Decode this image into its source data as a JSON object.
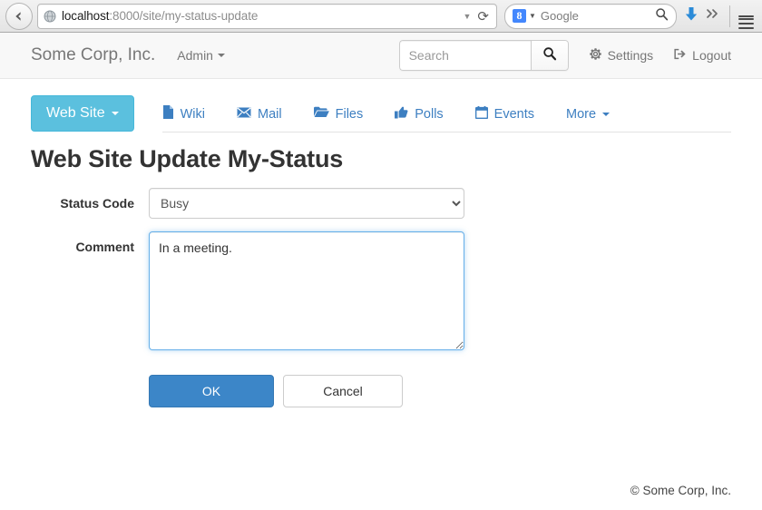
{
  "browser": {
    "back_icon": "back-arrow-icon",
    "site_icon": "globe-icon",
    "url_host": "localhost",
    "url_path": ":8000/site/my-status-update",
    "url_dropdown_icon": "chevron-down-icon",
    "reload_icon": "reload-icon",
    "search_engine_logo": "8",
    "search_engine_label": "Google",
    "search_magnifier_icon": "search-icon",
    "download_icon": "download-arrow-icon",
    "overflow_icon": "double-chevron-right-icon",
    "menu_icon": "hamburger-menu-icon"
  },
  "navbar": {
    "brand": "Some Corp, Inc.",
    "admin_label": "Admin",
    "admin_caret_icon": "caret-down-icon",
    "search": {
      "placeholder": "Search",
      "value": "",
      "button_icon": "search-icon"
    },
    "settings_label": "Settings",
    "settings_icon": "gear-icon",
    "logout_label": "Logout",
    "logout_icon": "sign-out-icon"
  },
  "tabs": {
    "site_button": {
      "label": "Web Site",
      "caret_icon": "caret-down-icon",
      "color": "#5bc0de"
    },
    "links": [
      {
        "label": "Wiki",
        "icon": "file-icon"
      },
      {
        "label": "Mail",
        "icon": "envelope-icon"
      },
      {
        "label": "Files",
        "icon": "folder-open-icon"
      },
      {
        "label": "Polls",
        "icon": "thumbs-up-icon"
      },
      {
        "label": "Events",
        "icon": "calendar-icon"
      },
      {
        "label": "More",
        "icon": "caret-down-icon"
      }
    ],
    "link_color": "#3d7fc1"
  },
  "page": {
    "title": "Web Site Update My-Status"
  },
  "form": {
    "status": {
      "label": "Status Code",
      "value": "Busy",
      "options": [
        "Busy"
      ]
    },
    "comment": {
      "label": "Comment",
      "value": "In a meeting.",
      "placeholder": ""
    },
    "ok_label": "OK",
    "cancel_label": "Cancel",
    "ok_color": "#3c86c8"
  },
  "footer": {
    "copyright": "© Some Corp, Inc."
  }
}
